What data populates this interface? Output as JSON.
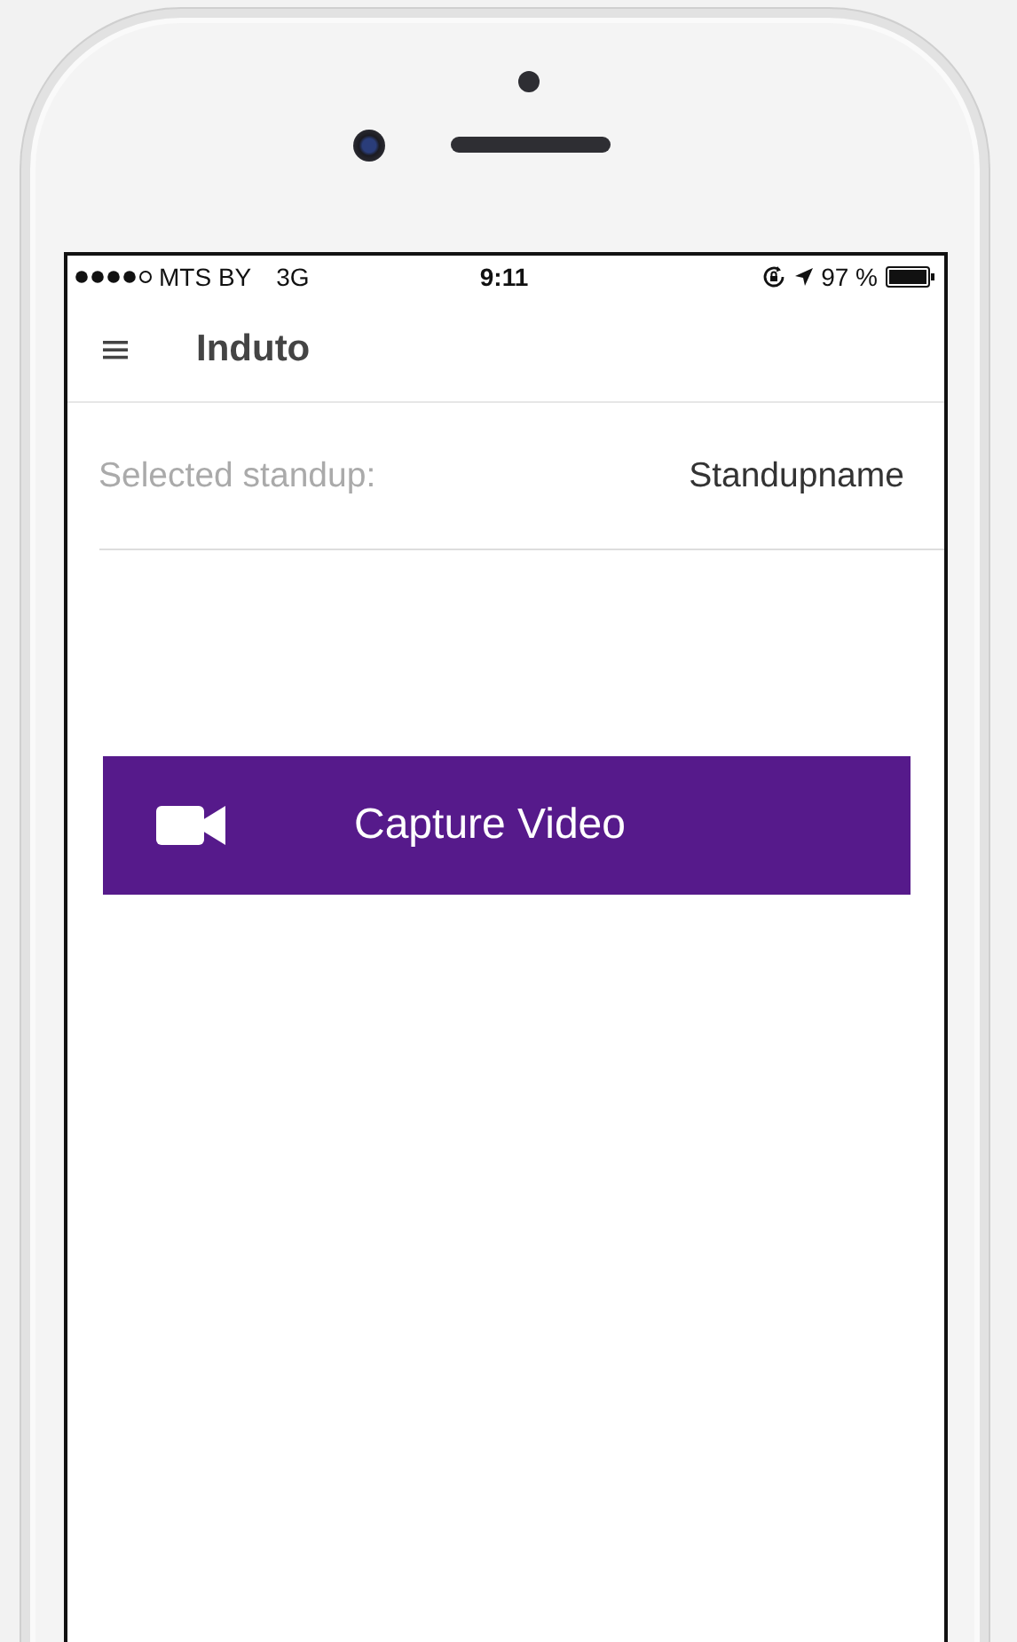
{
  "status_bar": {
    "carrier": "MTS BY",
    "network": "3G",
    "time": "9:11",
    "battery": "97 %"
  },
  "app_bar": {
    "title": "Induto"
  },
  "selected_standup": {
    "label": "Selected standup:",
    "value": "Standupname"
  },
  "capture_button": {
    "label": "Capture Video"
  }
}
